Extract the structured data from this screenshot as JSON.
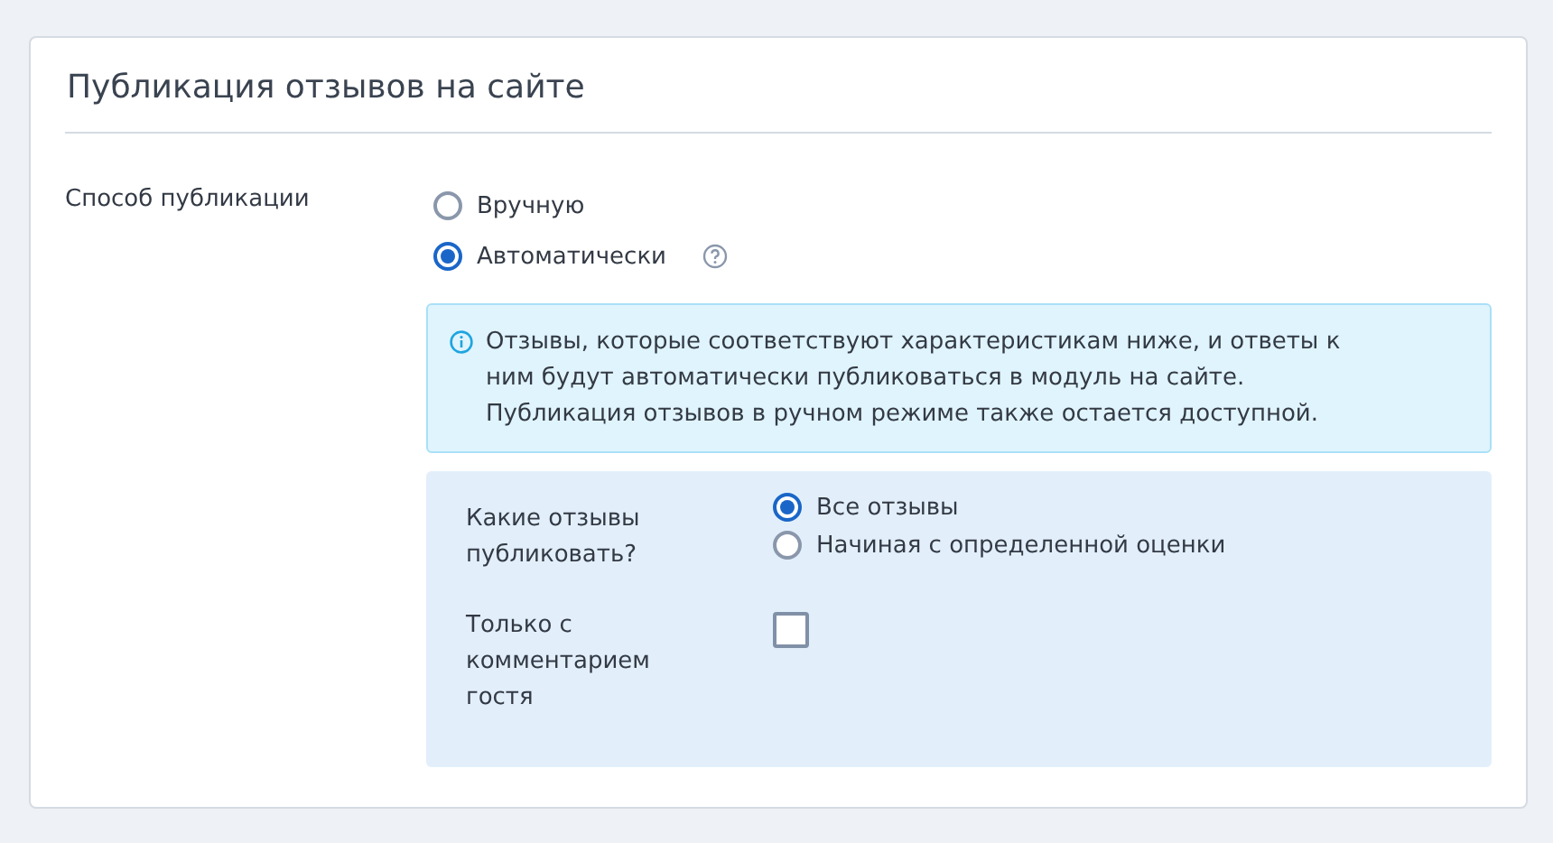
{
  "card": {
    "title": "Публикация отзывов на сайте"
  },
  "publish_method": {
    "label": "Способ публикации",
    "options": [
      {
        "label": "Вручную",
        "selected": false,
        "help_icon": false
      },
      {
        "label": "Автоматически",
        "selected": true,
        "help_icon": true
      }
    ]
  },
  "info": {
    "text": "Отзывы, которые соответствуют характеристикам ниже, и ответы к ним будут автоматически публиковаться в модуль на сайте. Публикация отзывов в ручном режиме также остается доступной."
  },
  "settings": [
    {
      "kind": "radio",
      "label": "Какие отзывы публиковать?",
      "options": [
        {
          "label": "Все отзывы",
          "selected": true
        },
        {
          "label": "Начиная с определенной оценки",
          "selected": false
        }
      ]
    },
    {
      "kind": "checkbox",
      "label": "Только с комментарием гостя",
      "checked": false
    }
  ]
}
